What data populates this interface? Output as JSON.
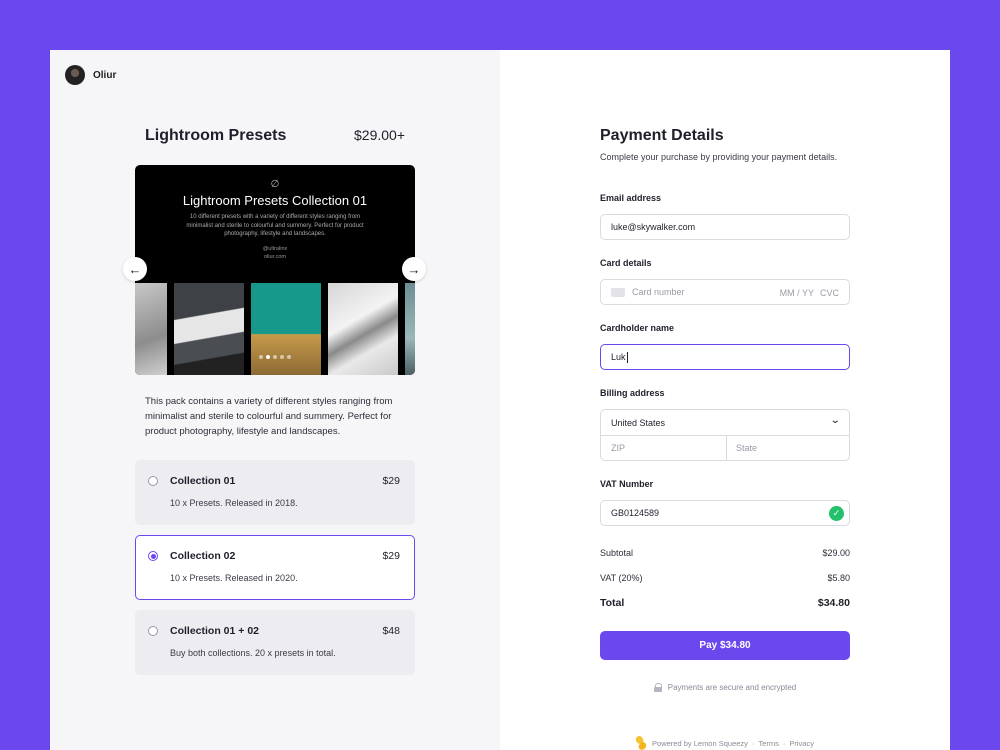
{
  "seller": {
    "name": "Oliur"
  },
  "product": {
    "title": "Lightroom Presets",
    "price": "$29.00+",
    "description": "This pack contains a variety of different styles ranging from minimalist and sterile to colourful and summery. Perfect for product photography, lifestyle and landscapes."
  },
  "gallery": {
    "logo": "∅",
    "title": "Lightroom Presets Collection 01",
    "description": "10 different presets with a variety of different styles ranging from minimalist and sterile to colourful and summery. Perfect for product photography, lifestyle and landscapes.",
    "handle": "@ultralinx",
    "site": "oliur.com",
    "prev_icon": "←",
    "next_icon": "→",
    "active_slide": 1,
    "slide_count": 5
  },
  "options": [
    {
      "name": "Collection 01",
      "price": "$29",
      "desc": "10 x Presets. Released in 2018.",
      "selected": false
    },
    {
      "name": "Collection 02",
      "price": "$29",
      "desc": "10 x Presets. Released in 2020.",
      "selected": true
    },
    {
      "name": "Collection 01 + 02",
      "price": "$48",
      "desc": "Buy both collections. 20 x presets in total.",
      "selected": false
    }
  ],
  "payment": {
    "title": "Payment Details",
    "subtitle": "Complete your purchase by providing your payment details.",
    "email_label": "Email address",
    "email_value": "luke@skywalker.com",
    "card_label": "Card details",
    "card_placeholder": "Card number",
    "card_expiry_placeholder": "MM / YY",
    "card_cvc_placeholder": "CVC",
    "cardholder_label": "Cardholder name",
    "cardholder_value": "Luk",
    "billing_label": "Billing address",
    "country": "United States",
    "zip_placeholder": "ZIP",
    "state_placeholder": "State",
    "vat_label": "VAT Number",
    "vat_value": "GB0124589",
    "vat_valid_icon": "✓"
  },
  "summary": {
    "subtotal_label": "Subtotal",
    "subtotal_value": "$29.00",
    "vat_label": "VAT (20%)",
    "vat_value": "$5.80",
    "total_label": "Total",
    "total_value": "$34.80"
  },
  "pay_button": "Pay $34.80",
  "secure_text": "Payments are secure and encrypted",
  "footer": {
    "powered": "Powered by Lemon Squeezy",
    "sep": "·",
    "terms": "Terms",
    "privacy": "Privacy"
  },
  "colors": {
    "accent": "#6b47ee",
    "background": "#6b47ee",
    "success": "#23c16b"
  }
}
